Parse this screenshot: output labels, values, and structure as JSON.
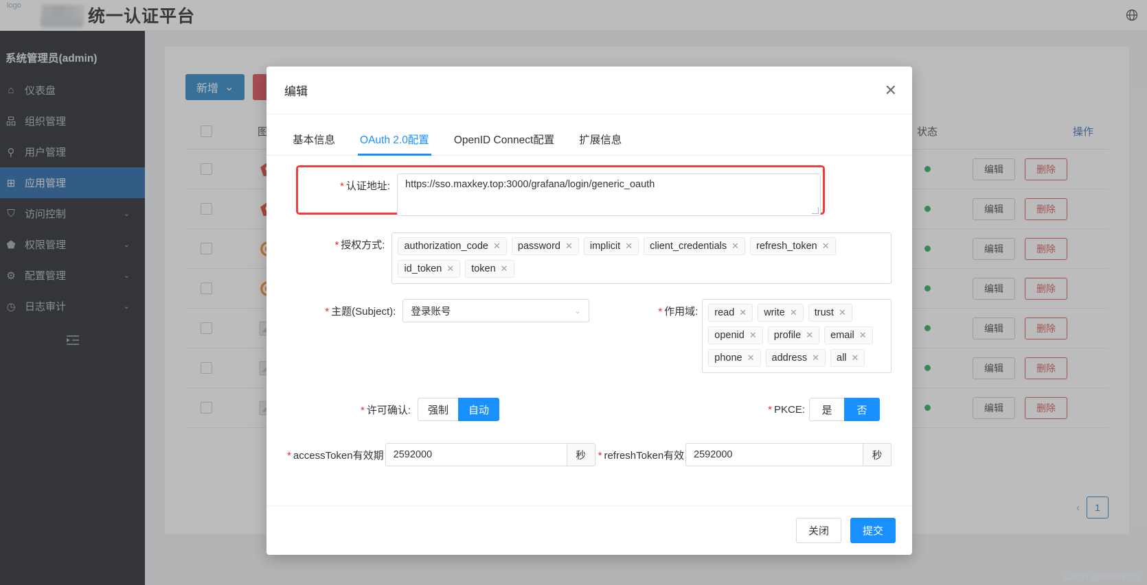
{
  "header": {
    "logo_alt": "logo",
    "title": "统一认证平台",
    "globe_icon": "globe-icon"
  },
  "sidebar": {
    "user": "系统管理员(admin)",
    "items": [
      {
        "icon": "dashboard-icon",
        "glyph": "⌂",
        "label": "仪表盘",
        "active": false,
        "expandable": false
      },
      {
        "icon": "organization-icon",
        "glyph": "品",
        "label": "组织管理",
        "active": false,
        "expandable": false
      },
      {
        "icon": "user-icon",
        "glyph": "⚲",
        "label": "用户管理",
        "active": false,
        "expandable": false
      },
      {
        "icon": "application-icon",
        "glyph": "⊞",
        "label": "应用管理",
        "active": true,
        "expandable": false
      },
      {
        "icon": "access-control-icon",
        "glyph": "⛉",
        "label": "访问控制",
        "active": false,
        "expandable": true
      },
      {
        "icon": "permission-icon",
        "glyph": "⬟",
        "label": "权限管理",
        "active": false,
        "expandable": true
      },
      {
        "icon": "settings-icon",
        "glyph": "⚙",
        "label": "配置管理",
        "active": false,
        "expandable": true
      },
      {
        "icon": "audit-log-icon",
        "glyph": "◷",
        "label": "日志审计",
        "active": false,
        "expandable": true
      }
    ],
    "collapse_icon": "collapse-sidebar-icon",
    "collapse_glyph": "⇥"
  },
  "page": {
    "add_button": "新增",
    "add_caret": "⌄",
    "delete_button": "",
    "table": {
      "columns": [
        "",
        "图标",
        "",
        "状态",
        "操作"
      ],
      "col_icon": "图标",
      "col_status": "状态",
      "col_ops": "操作",
      "row_edit": "编辑",
      "row_delete": "删除",
      "row_count": 7
    },
    "pagination": {
      "prev": "‹",
      "current": "1"
    }
  },
  "modal": {
    "title": "编辑",
    "close_icon": "close-icon",
    "close_glyph": "✕",
    "tabs": [
      {
        "label": "基本信息",
        "active": false
      },
      {
        "label": "OAuth 2.0配置",
        "active": true
      },
      {
        "label": "OpenID Connect配置",
        "active": false
      },
      {
        "label": "扩展信息",
        "active": false
      }
    ],
    "fields": {
      "auth_url": {
        "label": "认证地址:",
        "required": true,
        "value": "https://sso.maxkey.top:3000/grafana/login/generic_oauth",
        "highlighted": true,
        "highlight_color": "#f5393d"
      },
      "grant_types": {
        "label": "授权方式:",
        "required": true,
        "tags": [
          "authorization_code",
          "password",
          "implicit",
          "client_credentials",
          "refresh_token",
          "id_token",
          "token"
        ],
        "remove_glyph": "✕"
      },
      "subject": {
        "label": "主题(Subject):",
        "required": true,
        "value": "登录账号",
        "chevron": "⌄"
      },
      "scopes": {
        "label": "作用域:",
        "required": true,
        "tags": [
          "read",
          "write",
          "trust",
          "openid",
          "profile",
          "email",
          "phone",
          "address",
          "all"
        ],
        "remove_glyph": "✕"
      },
      "approval": {
        "label": "许可确认:",
        "required": true,
        "options": [
          "强制",
          "自动"
        ],
        "selected": "自动"
      },
      "pkce": {
        "label": "PKCE:",
        "required": true,
        "options": [
          "是",
          "否"
        ],
        "selected": "否"
      },
      "access_token": {
        "label": "accessToken有效期",
        "required": true,
        "value": "2592000",
        "unit": "秒"
      },
      "refresh_token": {
        "label": "refreshToken有效期",
        "required": true,
        "value": "2592000",
        "unit": "秒"
      }
    },
    "footer": {
      "close": "关闭",
      "submit": "提交"
    }
  },
  "watermark": "CSDN @memory23",
  "colors": {
    "primary": "#1890ff",
    "sidebar_active": "#1258a0",
    "danger": "#cf4b4b",
    "highlight": "#f5393d"
  }
}
